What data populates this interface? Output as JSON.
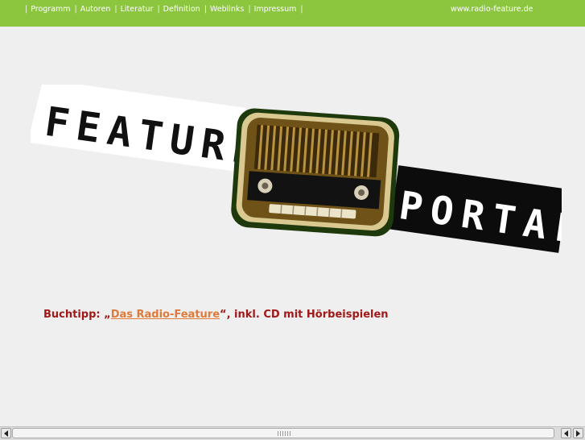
{
  "nav": {
    "items": [
      "Programm",
      "Autoren",
      "Literatur",
      "Definition",
      "Weblinks",
      "Impressum"
    ],
    "separator": "|"
  },
  "header": {
    "site_url": "www.radio-feature.de"
  },
  "logo": {
    "word_left": "FEATURE",
    "word_right": "PORTAL"
  },
  "booktip": {
    "prefix": "Buchtipp: „",
    "link_text": "Das Radio-Feature",
    "suffix": "“, inkl. CD mit Hörbeispielen"
  },
  "colors": {
    "topbar": "#8cc63f",
    "booktip_text": "#a01818",
    "booktip_link": "#e07a3a"
  },
  "icons": {
    "scroll_left": "triangle-left-icon",
    "scroll_right": "triangle-right-icon"
  }
}
